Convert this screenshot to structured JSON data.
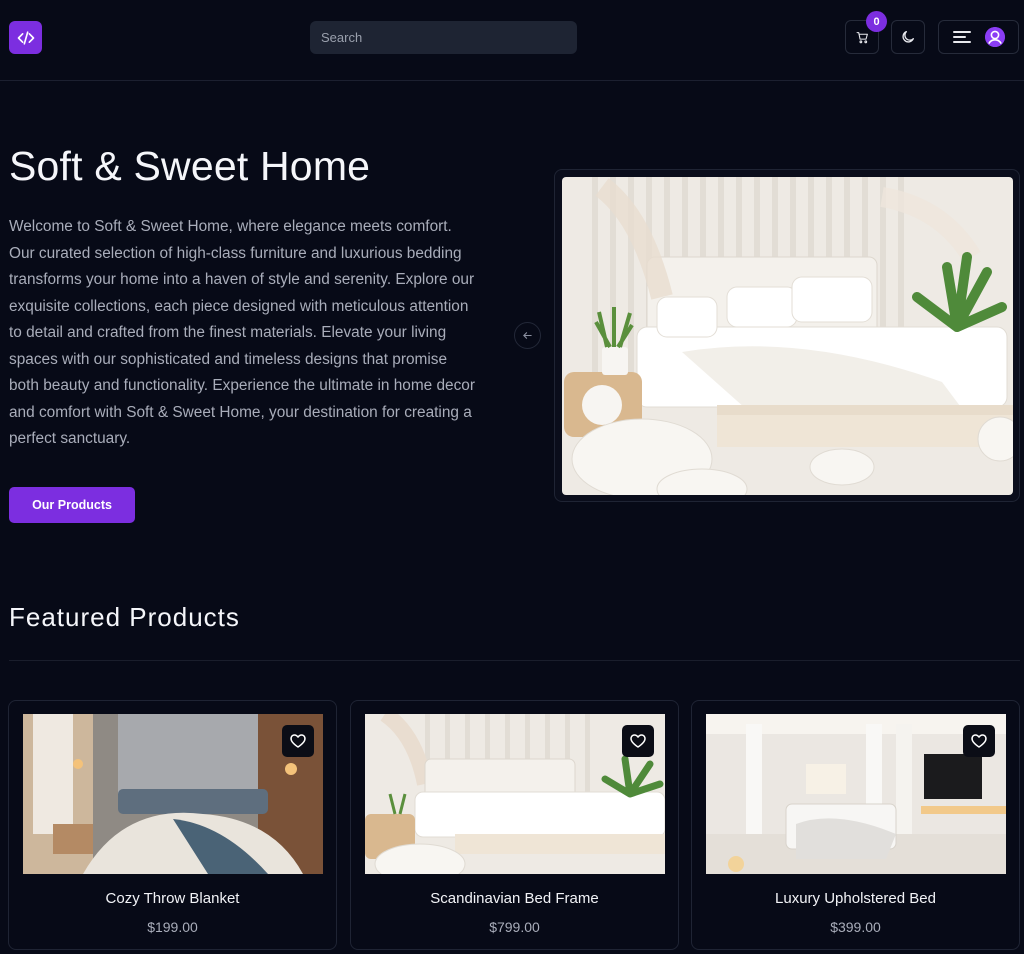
{
  "brand": {
    "logo_icon": "code-icon",
    "accent": "#7c2ee0"
  },
  "search": {
    "placeholder": "Search"
  },
  "header": {
    "cart_count": "0",
    "cart_icon": "cart-icon",
    "theme_icon": "moon-icon",
    "menu_icon": "menu-icon",
    "avatar_icon": "user-avatar-icon"
  },
  "hero": {
    "title": "Soft & Sweet Home",
    "description": "Welcome to Soft & Sweet Home, where elegance meets comfort. Our curated selection of high-class furniture and luxurious bedding transforms your home into a haven of style and serenity. Explore our exquisite collections, each piece designed with meticulous attention to detail and crafted from the finest materials. Elevate your living spaces with our sophisticated and timeless designs that promise both beauty and functionality. Experience the ultimate in home decor and comfort with Soft & Sweet Home, your destination for creating a perfect sanctuary.",
    "cta_label": "Our Products",
    "carousel_prev_icon": "arrow-left-icon"
  },
  "featured": {
    "title": "Featured Products",
    "products": [
      {
        "name": "Cozy Throw Blanket",
        "price": "$199.00"
      },
      {
        "name": "Scandinavian Bed Frame",
        "price": "$799.00"
      },
      {
        "name": "Luxury Upholstered Bed",
        "price": "$399.00"
      }
    ]
  },
  "colors": {
    "background": "#070a17",
    "surface": "#1e2433",
    "border": "#1f2434",
    "muted_text": "#a9adba"
  }
}
